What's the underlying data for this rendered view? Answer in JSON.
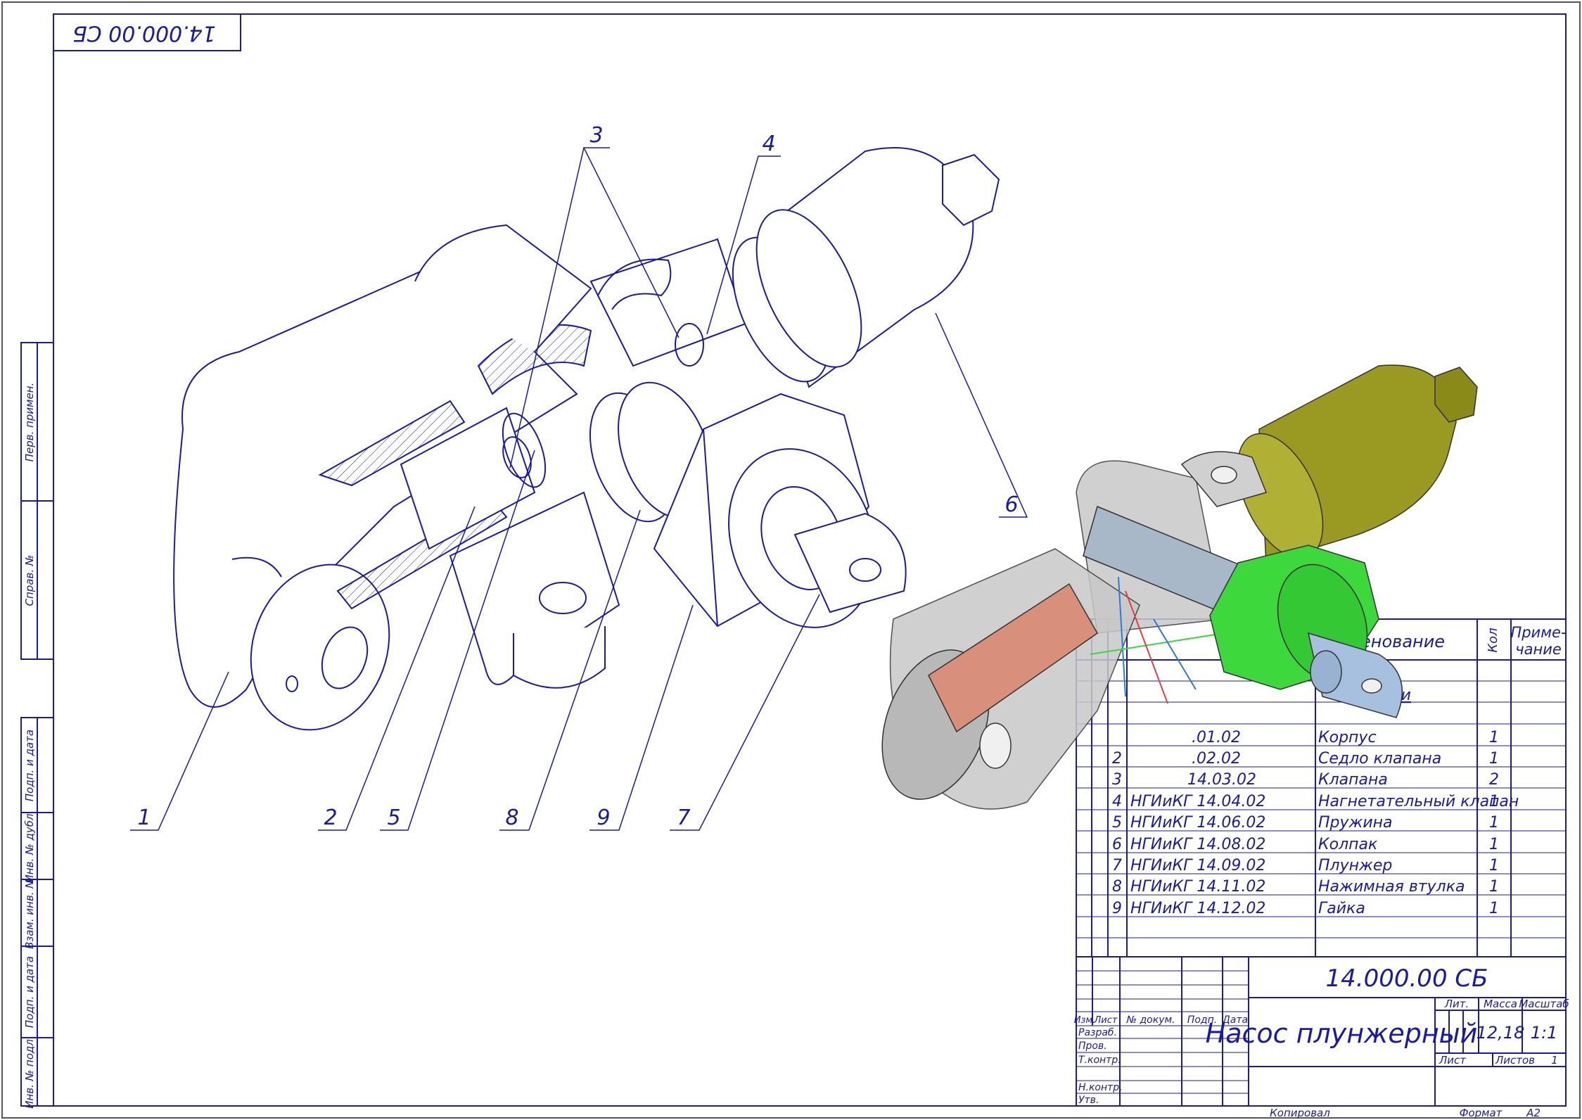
{
  "stamp_top": "14.000.00 СБ",
  "side_labels": [
    "Перв. примен.",
    "Справ. №",
    "Подп. и дата",
    "Инв. № дубл.",
    "Взам. инв. №",
    "Подп. и дата",
    "Инв. № подл."
  ],
  "callouts": [
    "1",
    "2",
    "3",
    "4",
    "5",
    "6",
    "7",
    "8",
    "9"
  ],
  "spec": {
    "header_name": "менование",
    "header_qty": "Кол",
    "header_note_1": "Приме-",
    "header_note_2": "чание",
    "section_label": "али",
    "rows": [
      {
        "pos": "",
        "designation": ".01.02",
        "name": "Корпус",
        "qty": "1"
      },
      {
        "pos": "2",
        "designation": ".02.02",
        "name": "Седло клапана",
        "qty": "1"
      },
      {
        "pos": "3",
        "designation": "14.03.02",
        "name": "Клапана",
        "qty": "2"
      },
      {
        "pos": "4",
        "designation": "НГИиКГ  14.04.02",
        "name": "Нагнетательный клапан",
        "qty": "1"
      },
      {
        "pos": "5",
        "designation": "НГИиКГ  14.06.02",
        "name": "Пружина",
        "qty": "1"
      },
      {
        "pos": "6",
        "designation": "НГИиКГ  14.08.02",
        "name": "Колпак",
        "qty": "1"
      },
      {
        "pos": "7",
        "designation": "НГИиКГ  14.09.02",
        "name": "Плунжер",
        "qty": "1"
      },
      {
        "pos": "8",
        "designation": "НГИиКГ  14.11.02",
        "name": "Нажимная втулка",
        "qty": "1"
      },
      {
        "pos": "9",
        "designation": "НГИиКГ  14.12.02",
        "name": "Гайка",
        "qty": "1"
      }
    ]
  },
  "title_block": {
    "doc_number": "14.000.00 СБ",
    "title": "Насос плунжерный",
    "col_izm": "Изм.",
    "col_list": "Лист",
    "col_docnum": "№ докум.",
    "col_sign": "Подп.",
    "col_date": "Дата",
    "role_develop": "Разраб.",
    "role_check": "Пров.",
    "role_tcontrol": "Т.контр.",
    "role_ncontrol": "Н.контр.",
    "role_approve": "Утв.",
    "lit_label": "Лит.",
    "mass_label": "Масса",
    "scale_label": "Масштаб",
    "mass_value": "12,18",
    "scale_value": "1:1",
    "sheet_label": "Лист",
    "sheets_label": "Листов",
    "sheets_value": "1",
    "copied_label": "Копировал",
    "format_label": "Формат",
    "format_value": "А2"
  },
  "colors": {
    "line": "#1a1aa8",
    "cap": "#9a9a22",
    "nut": "#3cd83c",
    "plunger": "#d8907a",
    "rod": "#a8b8c8",
    "body": "#c8c8c8"
  }
}
